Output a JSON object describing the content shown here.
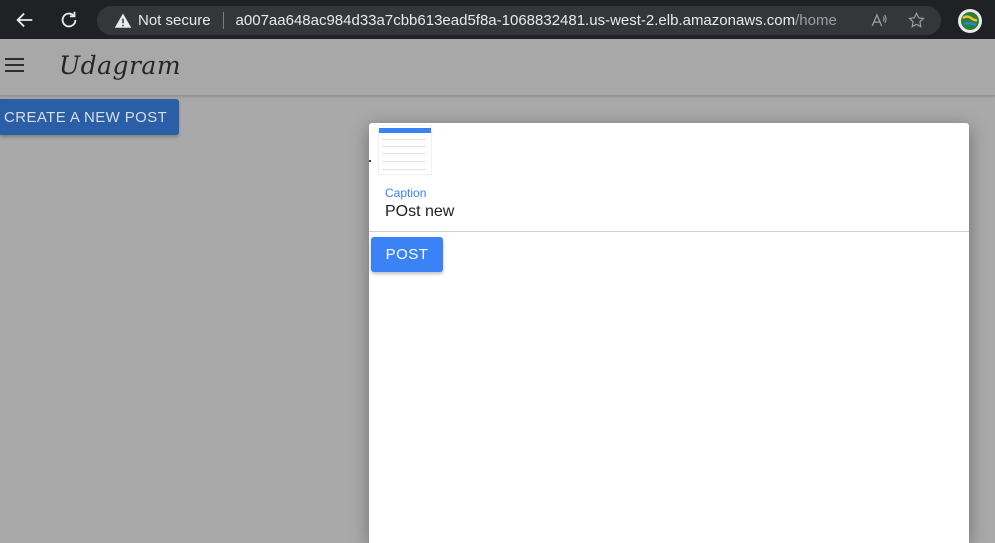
{
  "browser": {
    "security_text": "Not secure",
    "url_host": "a007aa648ac984d33a7cbb613ead5f8a-1068832481.us-west-2.elb.amazonaws.com",
    "url_path": "/home"
  },
  "app": {
    "brand": "Udagram",
    "create_button": "CREATE A NEW POST"
  },
  "modal": {
    "caption_label": "Caption",
    "caption_value": "POst new",
    "post_button": "POST"
  },
  "colors": {
    "accent": "#3b82f6",
    "overlay": "#a9a9a9"
  }
}
